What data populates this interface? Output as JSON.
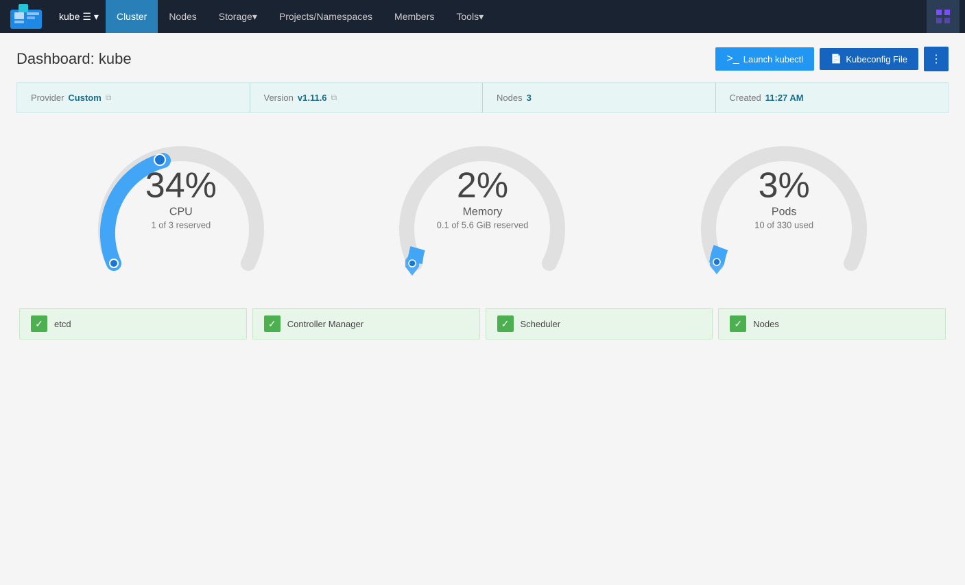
{
  "nav": {
    "logo_alt": "Rancher",
    "cluster_name": "kube",
    "items": [
      {
        "id": "cluster",
        "label": "Cluster",
        "active": true,
        "has_dropdown": false
      },
      {
        "id": "nodes",
        "label": "Nodes",
        "active": false,
        "has_dropdown": false
      },
      {
        "id": "storage",
        "label": "Storage",
        "active": false,
        "has_dropdown": true
      },
      {
        "id": "projects",
        "label": "Projects/Namespaces",
        "active": false,
        "has_dropdown": false
      },
      {
        "id": "members",
        "label": "Members",
        "active": false,
        "has_dropdown": false
      },
      {
        "id": "tools",
        "label": "Tools",
        "active": false,
        "has_dropdown": true
      }
    ]
  },
  "page": {
    "title": "Dashboard: kube",
    "buttons": {
      "kubectl": "Launch kubectl",
      "kubeconfig": "Kubeconfig File",
      "more": "⋮"
    }
  },
  "info_bar": {
    "provider_label": "Provider",
    "provider_value": "Custom",
    "version_label": "Version",
    "version_value": "v1.11.6",
    "nodes_label": "Nodes",
    "nodes_value": "3",
    "created_label": "Created",
    "created_value": "11:27 AM"
  },
  "gauges": [
    {
      "id": "cpu",
      "percent": "34%",
      "label": "CPU",
      "sub": "1 of 3 reserved",
      "value": 34,
      "color": "#42a5f5",
      "indicator_side": "left"
    },
    {
      "id": "memory",
      "percent": "2%",
      "label": "Memory",
      "sub": "0.1 of 5.6 GiB reserved",
      "value": 2,
      "color": "#42a5f5",
      "indicator_side": "bottom"
    },
    {
      "id": "pods",
      "percent": "3%",
      "label": "Pods",
      "sub": "10 of 330 used",
      "value": 3,
      "color": "#42a5f5",
      "indicator_side": "bottom"
    }
  ],
  "status_items": [
    {
      "id": "etcd",
      "label": "etcd",
      "status": "ok"
    },
    {
      "id": "controller-manager",
      "label": "Controller Manager",
      "status": "ok"
    },
    {
      "id": "scheduler",
      "label": "Scheduler",
      "status": "ok"
    },
    {
      "id": "nodes",
      "label": "Nodes",
      "status": "ok"
    }
  ]
}
